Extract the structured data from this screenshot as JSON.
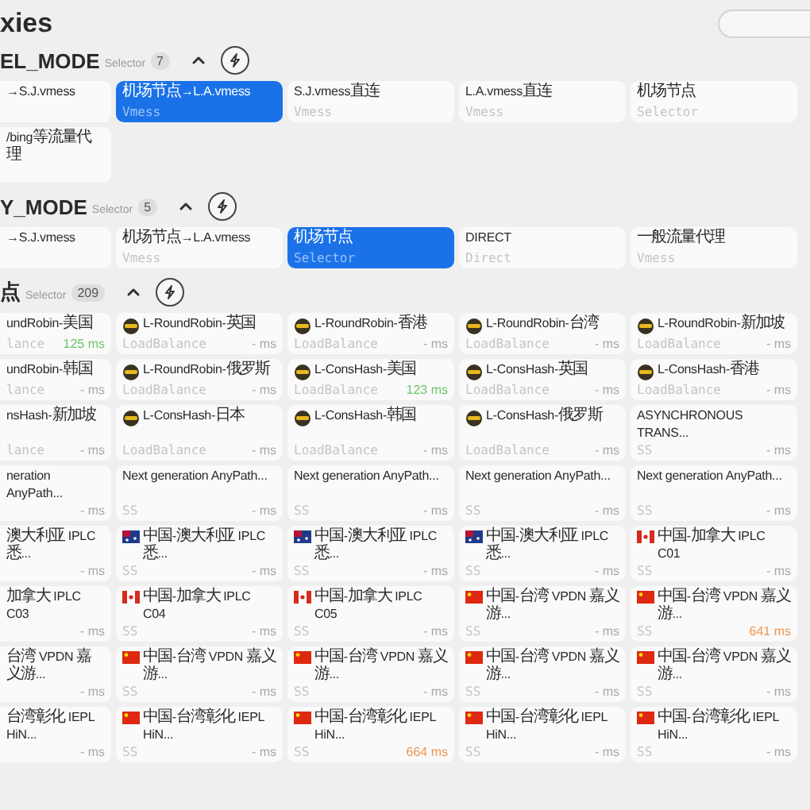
{
  "page": {
    "title": "xies"
  },
  "groups": [
    {
      "name": "EL_MODE",
      "type": "Selector",
      "count": "7",
      "expanded": true,
      "cards": [
        {
          "name": "→S.J.vmess",
          "selected": false
        },
        {
          "name": "机场节点→L.A.vmess",
          "type": "Vmess",
          "selected": true
        },
        {
          "name": "S.J.vmess直连",
          "type": "Vmess",
          "selected": false
        },
        {
          "name": "L.A.vmess直连",
          "type": "Vmess",
          "selected": false
        },
        {
          "name": "机场节点",
          "type": "Selector",
          "selected": false
        },
        {
          "name": "/bing等流量代理",
          "selected": false
        }
      ]
    },
    {
      "name": "Y_MODE",
      "type": "Selector",
      "count": "5",
      "expanded": true,
      "cards": [
        {
          "name": "→S.J.vmess",
          "selected": false
        },
        {
          "name": "机场节点→L.A.vmess",
          "type": "Vmess",
          "selected": false
        },
        {
          "name": "机场节点",
          "type": "Selector",
          "selected": true
        },
        {
          "name": "DIRECT",
          "type": "Direct",
          "selected": false
        },
        {
          "name": "一般流量代理",
          "type": "Vmess",
          "selected": false
        }
      ]
    },
    {
      "name": "点",
      "type": "Selector",
      "count": "209",
      "expanded": true,
      "cards": [
        {
          "name": "undRobin-美国",
          "type": "lance",
          "delay": "125 ms",
          "color": "#6cc66a",
          "selected": false
        },
        {
          "name": "L-RoundRobin-英国",
          "kind": "loadbalance",
          "type": "LoadBalance",
          "delay": "- ms",
          "selected": false
        },
        {
          "name": "L-RoundRobin-香港",
          "kind": "loadbalance",
          "type": "LoadBalance",
          "delay": "- ms",
          "selected": false
        },
        {
          "name": "L-RoundRobin-台湾",
          "kind": "loadbalance",
          "type": "LoadBalance",
          "delay": "- ms",
          "selected": false
        },
        {
          "name": "L-RoundRobin-新加坡",
          "kind": "loadbalance",
          "type": "LoadBalance",
          "delay": "- ms",
          "selected": false
        },
        {
          "name": "undRobin-韩国",
          "type": "lance",
          "delay": "- ms",
          "selected": false
        },
        {
          "name": "L-RoundRobin-俄罗斯",
          "kind": "loadbalance",
          "type": "LoadBalance",
          "delay": "- ms",
          "selected": false
        },
        {
          "name": "L-ConsHash-美国",
          "kind": "loadbalance",
          "type": "LoadBalance",
          "delay": "123 ms",
          "color": "#6cc66a",
          "selected": false
        },
        {
          "name": "L-ConsHash-英国",
          "kind": "loadbalance",
          "type": "LoadBalance",
          "delay": "- ms",
          "selected": false
        },
        {
          "name": "L-ConsHash-香港",
          "kind": "loadbalance",
          "type": "LoadBalance",
          "delay": "- ms",
          "selected": false
        },
        {
          "name": "nsHash-新加坡",
          "type": "lance",
          "delay": "- ms",
          "selected": false
        },
        {
          "name": "L-ConsHash-日本",
          "kind": "loadbalance",
          "type": "LoadBalance",
          "delay": "- ms",
          "selected": false
        },
        {
          "name": "L-ConsHash-韩国",
          "kind": "loadbalance",
          "type": "LoadBalance",
          "delay": "- ms",
          "selected": false
        },
        {
          "name": "L-ConsHash-俄罗斯",
          "kind": "loadbalance",
          "type": "LoadBalance",
          "delay": "- ms",
          "selected": false
        },
        {
          "name": "ASYNCHRONOUS TRANS...",
          "type": "SS",
          "delay": "- ms",
          "selected": false
        },
        {
          "name": "neration AnyPath...",
          "delay": "- ms",
          "selected": false
        },
        {
          "name": "Next generation AnyPath...",
          "type": "SS",
          "delay": "- ms",
          "selected": false
        },
        {
          "name": "Next generation AnyPath...",
          "type": "SS",
          "delay": "- ms",
          "selected": false
        },
        {
          "name": "Next generation AnyPath...",
          "type": "SS",
          "delay": "- ms",
          "selected": false
        },
        {
          "name": "Next generation AnyPath...",
          "type": "SS",
          "delay": "- ms",
          "selected": false
        },
        {
          "name": "澳大利亚 IPLC 悉...",
          "delay": "- ms",
          "selected": false
        },
        {
          "name": "中国-澳大利亚 IPLC 悉...",
          "kind": "australia",
          "type": "SS",
          "delay": "- ms",
          "selected": false
        },
        {
          "name": "中国-澳大利亚 IPLC 悉...",
          "kind": "australia",
          "type": "SS",
          "delay": "- ms",
          "selected": false
        },
        {
          "name": "中国-澳大利亚 IPLC 悉...",
          "kind": "australia",
          "type": "SS",
          "delay": "- ms",
          "selected": false
        },
        {
          "name": "中国-加拿大 IPLC C01",
          "kind": "canada",
          "type": "SS",
          "delay": "- ms",
          "selected": false
        },
        {
          "name": "加拿大 IPLC C03",
          "delay": "- ms",
          "selected": false
        },
        {
          "name": "中国-加拿大 IPLC C04",
          "kind": "canada",
          "type": "SS",
          "delay": "- ms",
          "selected": false
        },
        {
          "name": "中国-加拿大 IPLC C05",
          "kind": "canada",
          "type": "SS",
          "delay": "- ms",
          "selected": false
        },
        {
          "name": "中国-台湾 VPDN 嘉义游...",
          "kind": "china",
          "type": "SS",
          "delay": "- ms",
          "selected": false
        },
        {
          "name": "中国-台湾 VPDN 嘉义游...",
          "kind": "china",
          "type": "SS",
          "delay": "641 ms",
          "color": "#f0964e",
          "selected": false
        },
        {
          "name": "台湾 VPDN 嘉义游...",
          "delay": "- ms",
          "selected": false
        },
        {
          "name": "中国-台湾 VPDN 嘉义游...",
          "kind": "china",
          "type": "SS",
          "delay": "- ms",
          "selected": false
        },
        {
          "name": "中国-台湾 VPDN 嘉义游...",
          "kind": "china",
          "type": "SS",
          "delay": "- ms",
          "selected": false
        },
        {
          "name": "中国-台湾 VPDN 嘉义游...",
          "kind": "china",
          "type": "SS",
          "delay": "- ms",
          "selected": false
        },
        {
          "name": "中国-台湾 VPDN 嘉义游...",
          "kind": "china",
          "type": "SS",
          "delay": "- ms",
          "selected": false
        },
        {
          "name": "台湾彰化 IEPL HiN...",
          "delay": "- ms",
          "selected": false
        },
        {
          "name": "中国-台湾彰化 IEPL HiN...",
          "kind": "china",
          "type": "SS",
          "delay": "- ms",
          "selected": false
        },
        {
          "name": "中国-台湾彰化 IEPL HiN...",
          "kind": "china",
          "type": "SS",
          "delay": "664 ms",
          "color": "#f0964e",
          "selected": false
        },
        {
          "name": "中国-台湾彰化 IEPL HiN...",
          "kind": "china",
          "type": "SS",
          "delay": "- ms",
          "selected": false
        },
        {
          "name": "中国-台湾彰化 IEPL HiN...",
          "kind": "china",
          "type": "SS",
          "delay": "- ms",
          "selected": false
        }
      ]
    }
  ]
}
